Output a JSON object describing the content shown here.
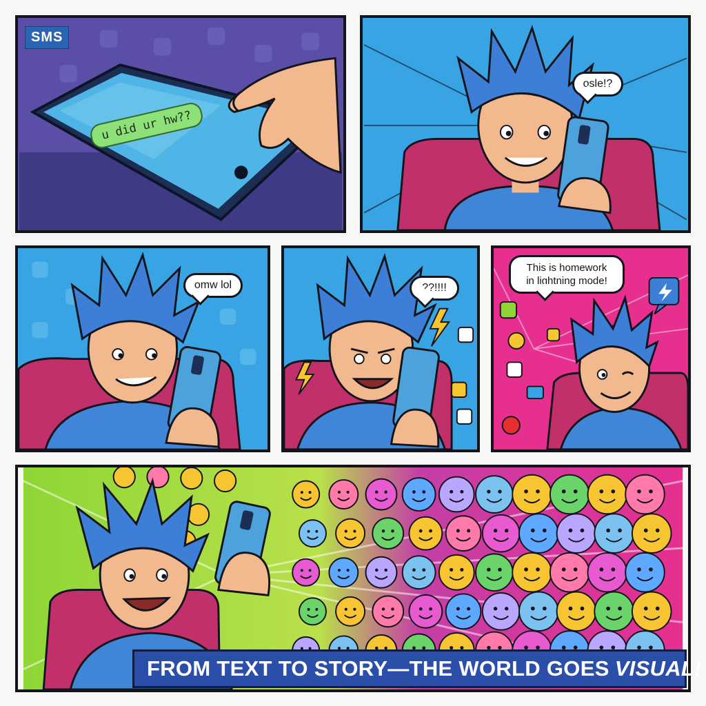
{
  "panel1": {
    "tag": "SMS",
    "message": "u did ur hw??"
  },
  "panel2": {
    "bubble": "osle!?"
  },
  "panel3": {
    "bubble": "omw lol"
  },
  "panel4": {
    "bubble": "??!!!!"
  },
  "panel5": {
    "bubble_line1": "This is homework",
    "bubble_line2": "in lightning mode!"
  },
  "caption": {
    "text": "FROM TEXT TO STORY—THE WORLD GOES",
    "emphasis": "VISUAL!"
  },
  "colors": {
    "hair": "#3d7fd6",
    "skin": "#f2b98f",
    "shirt": "#3f86d9",
    "chair": "#c2306b",
    "bg_blue": "#38a4e4",
    "bg_purple": "#5a4ea6",
    "bg_pink": "#e62f8f",
    "bg_green": "#8ed636",
    "emoji_yellow": "#f6c531",
    "caption_bg": "#2b4fa8",
    "border": "#14141c"
  },
  "icons": [
    "phone-icon",
    "lightning-icon",
    "emoji-icon",
    "sparkle-icon",
    "chat-icon"
  ]
}
